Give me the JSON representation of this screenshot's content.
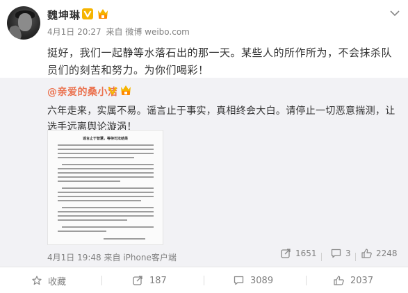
{
  "post": {
    "author": "魏坤琳",
    "date": "4月1日 20:27",
    "source": "来自 微博 weibo.com",
    "text": "挺好，我们一起静等水落石出的那一天。某些人的所作所为，不会抹杀队员们的刻苦和努力。为你们喝彩！"
  },
  "repost": {
    "author": "@亲爱的桑小洁",
    "text": "六年走来，实属不易。谣言止于事实，真相终会大白。请停止一切恶意揣测，让选手远离舆论漩涡！",
    "image_title": "谣言止于智慧，等待司法结果",
    "date": "4月1日 19:48",
    "source": "来自 iPhone客户端",
    "reposts": "1651",
    "comments": "3",
    "likes": "2248"
  },
  "actions": {
    "favorite_label": "收藏",
    "repost_count": "187",
    "comment_count": "3089",
    "like_count": "2037"
  },
  "colors": {
    "link_orange": "#eb7350",
    "muted_gray": "#808080",
    "repost_bg": "#f2f2f5",
    "vip_gold": "#f5b400"
  }
}
